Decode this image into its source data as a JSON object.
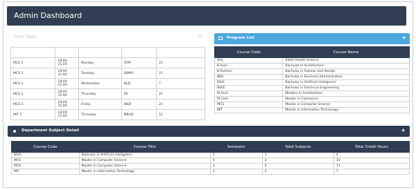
{
  "header": {
    "title": "Admin Dashboard"
  },
  "schedule": {
    "title": "Time Table",
    "rows": [
      [
        "MCS 2",
        "18:00\n21:00",
        "Monday",
        "OOP",
        "21"
      ],
      [
        "MCS 2",
        "18:00\n21:00",
        "Tuesday",
        "DBMS",
        "21"
      ],
      [
        "MCS 2",
        "18:00\n21:00",
        "Wednesday",
        "DLD",
        "7"
      ],
      [
        "MCS 2",
        "18:00\n21:00",
        "Thursday",
        "SE",
        "21"
      ],
      [
        "MCS 2",
        "18:00\n21:00",
        "Friday",
        "WEB",
        "21"
      ],
      [
        "MIT 2",
        "18:00\n21:00",
        "Thursday",
        "MBAD",
        "12"
      ]
    ]
  },
  "program_list": {
    "title": "Program List",
    "columns": [
      "Course Code",
      "Course Name"
    ],
    "rows": [
      [
        "AHL",
        "Allied Health Science"
      ],
      [
        "B.Arch",
        "Bachular in Architecture"
      ],
      [
        "B.Fashion",
        "Bachular in Fashion and Design"
      ],
      [
        "BBA",
        "Bachular in Business Administration"
      ],
      [
        "BSAI",
        "Bachular in Artificial Inteligence"
      ],
      [
        "BSEE",
        "Bachular in Electrical Engineering"
      ],
      [
        "M.Arch",
        "Masters in Architecture"
      ],
      [
        "M.Com",
        "Master in Commerce"
      ],
      [
        "MCS",
        "Master in Computer Science"
      ],
      [
        "MIT",
        "Master in Information Technology"
      ]
    ]
  },
  "department": {
    "title": "Department Subject Detail",
    "columns": [
      "Course Code",
      "Course Title",
      "Semester",
      "Total Subjects",
      "Total Credit Hours"
    ],
    "rows": [
      [
        "BSAI",
        "Bachular in Artificial Inteligence",
        "1",
        "1",
        "4"
      ],
      [
        "MCS",
        "Master in Computer Science",
        "1",
        "3",
        "10"
      ],
      [
        "MCS",
        "Master in Computer Science",
        "2",
        "5",
        "17"
      ],
      [
        "MIT",
        "Master in Information Technology",
        "2",
        "2",
        "7"
      ]
    ]
  }
}
